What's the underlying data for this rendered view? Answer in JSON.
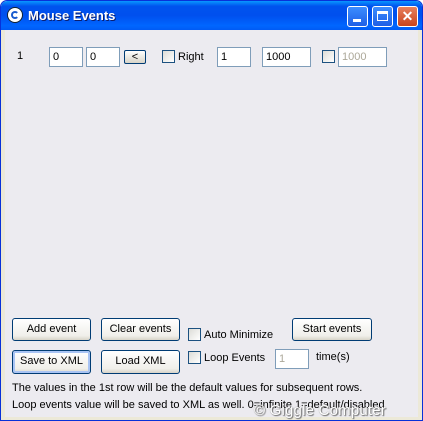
{
  "window": {
    "title": "Mouse Events",
    "minimize_icon": "minimize-icon",
    "maximize_icon": "maximize-icon",
    "close_icon": "close-icon",
    "close_glyph": "✕"
  },
  "rows": [
    {
      "index": "1",
      "x": "0",
      "y": "0",
      "capture_label": "<",
      "right_label": "Right",
      "right_checked": false,
      "clicks": "1",
      "delay": "1000",
      "extra_checked": false,
      "extra_value": "1000"
    }
  ],
  "controls": {
    "add_event": "Add event",
    "clear_events": "Clear events",
    "auto_minimize": "Auto Minimize",
    "start_events": "Start events",
    "save_xml": "Save to XML",
    "load_xml": "Load XML",
    "loop_events": "Loop Events",
    "loop_count": "1",
    "times_label": "time(s)"
  },
  "info": {
    "line1": "The values in the 1st row will be the default values for subsequent rows.",
    "line2": "Loop events value will be saved to XML as well. 0=infinite 1=default/disabled"
  },
  "watermark": "© Giggle Computer",
  "colors": {
    "titlebar": "#0053ee",
    "frame": "#0831d9",
    "close_button": "#c8441d",
    "panel": "#ecebf0"
  }
}
